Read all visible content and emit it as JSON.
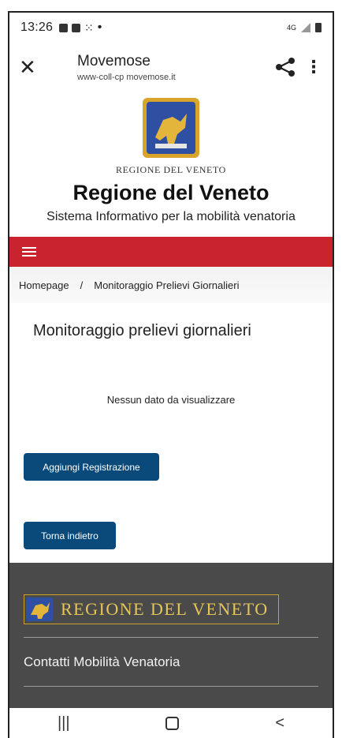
{
  "status": {
    "time": "13:26",
    "network": "4G"
  },
  "tab": {
    "title": "Movemose",
    "url": "www-coll-cp movemose.it"
  },
  "header": {
    "logo_caption": "REGIONE DEL VENETO",
    "title": "Regione del Veneto",
    "subtitle": "Sistema Informativo per la mobilità venatoria"
  },
  "breadcrumb": {
    "home": "Homepage",
    "separator": "/",
    "current": "Monitoraggio Prelievi Giornalieri"
  },
  "main": {
    "title": "Monitoraggio prelievi giornalieri",
    "empty": "Nessun dato da visualizzare",
    "add_button": "Aggiungi Registrazione",
    "back_button": "Torna indietro"
  },
  "footer": {
    "logo_text": "REGIONE DEL VENETO",
    "link": "Contatti Mobilità Venatoria"
  },
  "navbar": {
    "recent": "|||",
    "back": "<"
  },
  "colors": {
    "accent_red": "#c9232d",
    "button_blue": "#0a4a7a",
    "footer_bg": "#4a4a4a",
    "footer_gold": "#e6c65a"
  }
}
